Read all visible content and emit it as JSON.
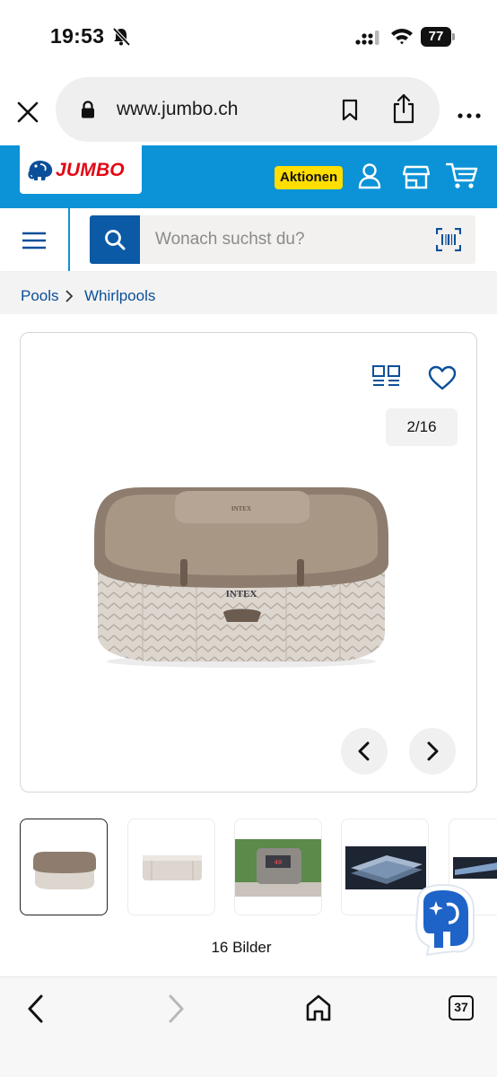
{
  "status_bar": {
    "time": "19:53",
    "battery": "77"
  },
  "browser": {
    "url": "www.jumbo.ch"
  },
  "header": {
    "logo_text": "JUMBO",
    "aktionen_label": "Aktionen",
    "brand_color": "#0c93d7",
    "logo_color": "#e30613",
    "badge_color": "#ffde00"
  },
  "search": {
    "placeholder": "Wonach suchst du?"
  },
  "breadcrumb": {
    "items": [
      "Pools",
      "Whirlpools"
    ]
  },
  "gallery": {
    "counter": "2/16",
    "image_count_label": "16 Bilder",
    "product_brand": "INTEX"
  },
  "bottom_bar": {
    "tab_count": "37"
  }
}
